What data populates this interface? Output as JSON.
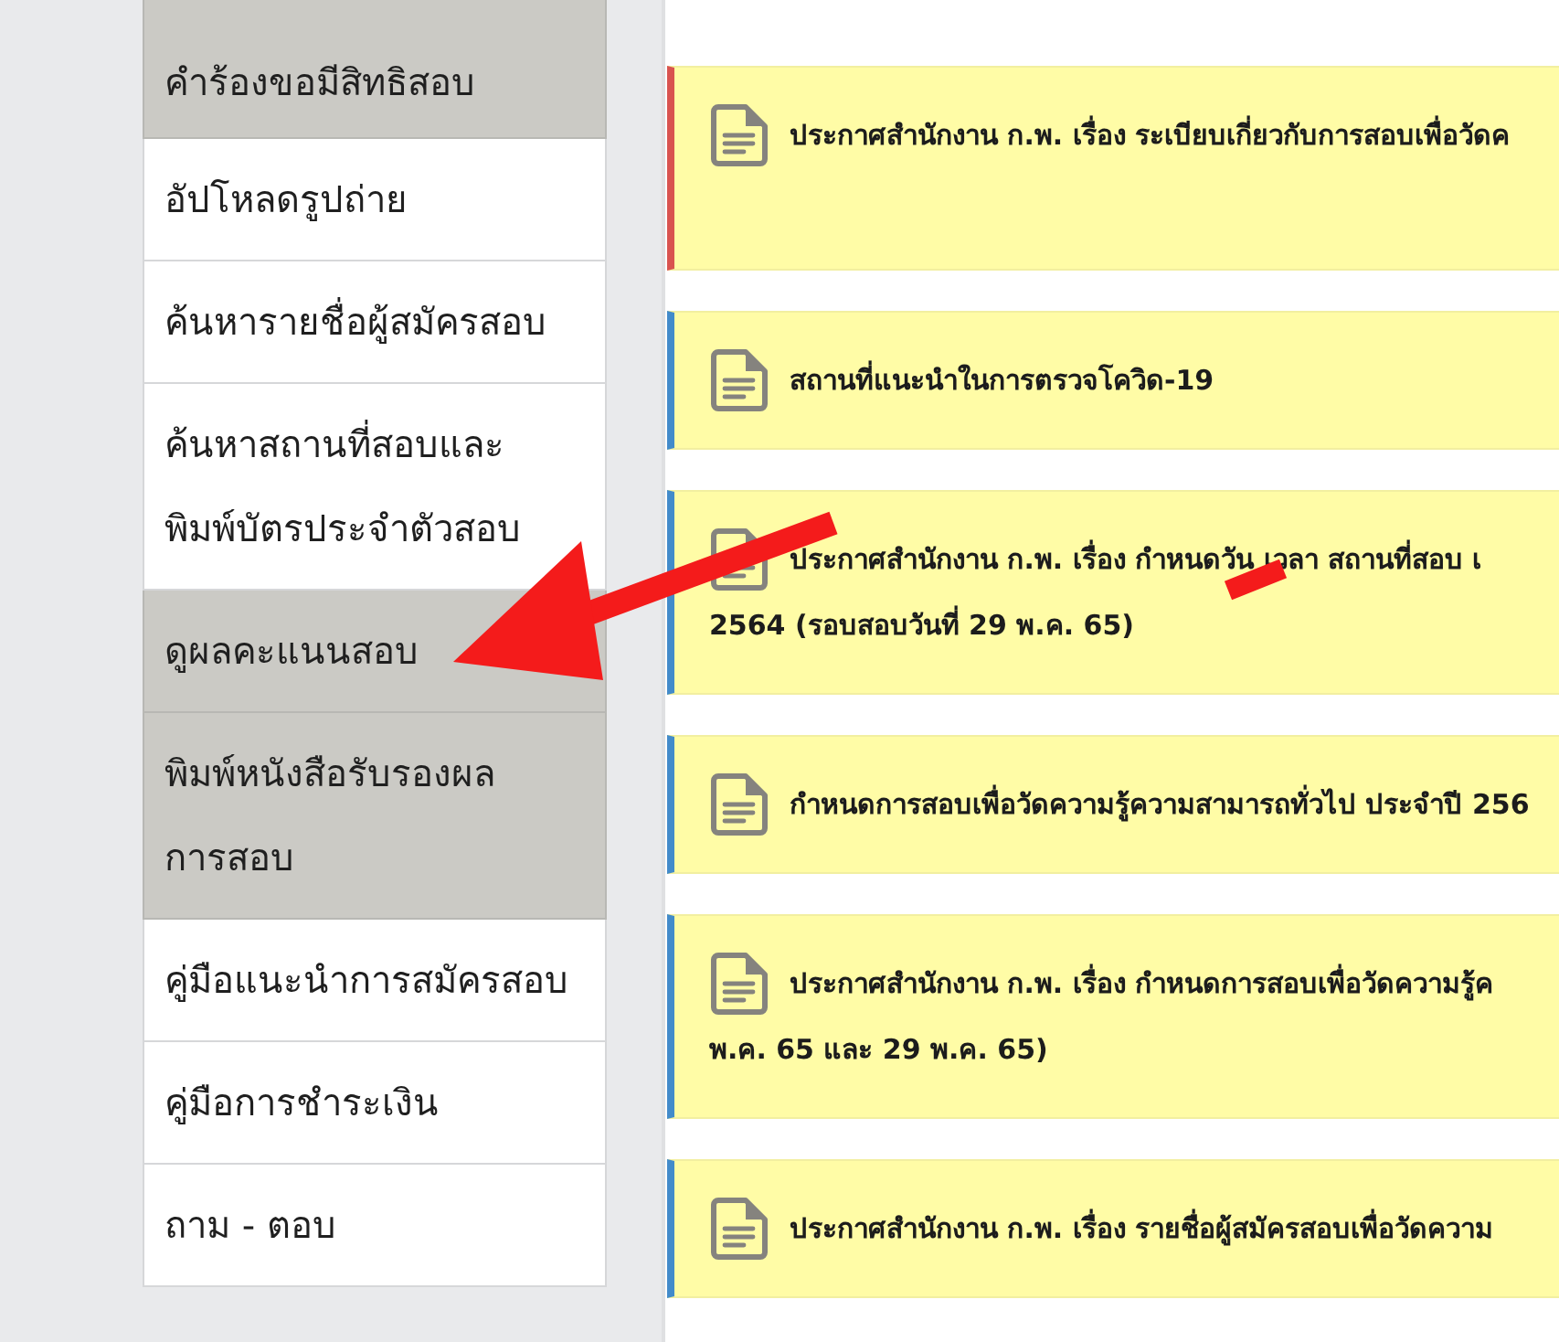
{
  "sidebar": {
    "items": [
      {
        "label": "คำร้องขอมีสิทธิสอบ",
        "highlighted": true
      },
      {
        "label": "อัปโหลดรูปถ่าย",
        "highlighted": false
      },
      {
        "label": "ค้นหารายชื่อผู้สมัครสอบ",
        "highlighted": false
      },
      {
        "label": "ค้นหาสถานที่สอบและ\nพิมพ์บัตรประจำตัวสอบ",
        "highlighted": false
      },
      {
        "label": "ดูผลคะแนนสอบ",
        "highlighted": true
      },
      {
        "label": "พิมพ์หนังสือรับรองผล\nการสอบ",
        "highlighted": true
      },
      {
        "label": "คู่มือแนะนำการสมัครสอบ",
        "highlighted": false
      },
      {
        "label": "คู่มือการชำระเงิน",
        "highlighted": false
      },
      {
        "label": "ถาม - ตอบ",
        "highlighted": false
      }
    ]
  },
  "announcements": [
    {
      "title": "ประกาศสำนักงาน ก.พ. เรื่อง ระเบียบเกี่ยวกับการสอบเพื่อวัดค",
      "color": "#d9534f"
    },
    {
      "title": "สถานที่แนะนำในการตรวจโควิด-19",
      "color": "#428bca"
    },
    {
      "title": "ประกาศสำนักงาน ก.พ. เรื่อง กำหนดวัน เวลา สถานที่สอบ เ\n2564 (รอบสอบวันที่ 29 พ.ค. 65)",
      "color": "#428bca"
    },
    {
      "title": "กำหนดการสอบเพื่อวัดความรู้ความสามารถทั่วไป ประจำปี 256",
      "color": "#428bca"
    },
    {
      "title": "ประกาศสำนักงาน ก.พ. เรื่อง กำหนดการสอบเพื่อวัดความรู้ค\nพ.ค. 65 และ 29 พ.ค. 65)",
      "color": "#428bca"
    },
    {
      "title": "ประกาศสำนักงาน ก.พ. เรื่อง รายชื่อผู้สมัครสอบเพื่อวัดความ",
      "color": "#428bca"
    }
  ]
}
